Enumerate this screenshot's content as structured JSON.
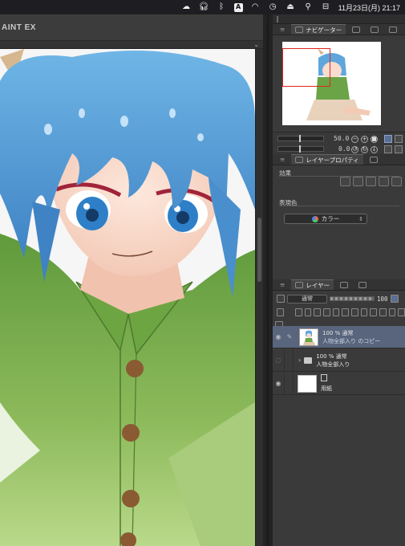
{
  "menubar": {
    "icons": [
      "cloud-upload-icon",
      "headphones-icon",
      "bluetooth-icon",
      "input-source-a-icon",
      "wifi-icon",
      "time-machine-icon",
      "eject-icon",
      "search-icon",
      "control-center-icon"
    ],
    "input_source": "A",
    "clock": "11月23日(月)  21:17"
  },
  "canvas": {
    "title": "AINT EX"
  },
  "navigator": {
    "tab_label": "ナビゲーター",
    "zoom": "50.0",
    "rotation": "0.0"
  },
  "layer_property": {
    "tab_label": "レイヤープロパティ",
    "effect_label": "効果",
    "expression_color_label": "表現色",
    "expression_color_value": "カラー"
  },
  "layer_panel": {
    "tab_label": "レイヤー",
    "blend_mode": "通常",
    "opacity": "100",
    "layers": [
      {
        "line1": "100 % 通常",
        "line2": "人物全部入り のコピー",
        "type": "raster",
        "selected": true
      },
      {
        "line1": "100 % 通常",
        "line2": "人物全部入り",
        "type": "folder",
        "selected": false
      },
      {
        "line1": "",
        "line2": "用紙",
        "type": "paper",
        "selected": false
      }
    ]
  },
  "colors": {
    "accent_selected": "#58657d",
    "nav_frame": "#e0261f"
  }
}
